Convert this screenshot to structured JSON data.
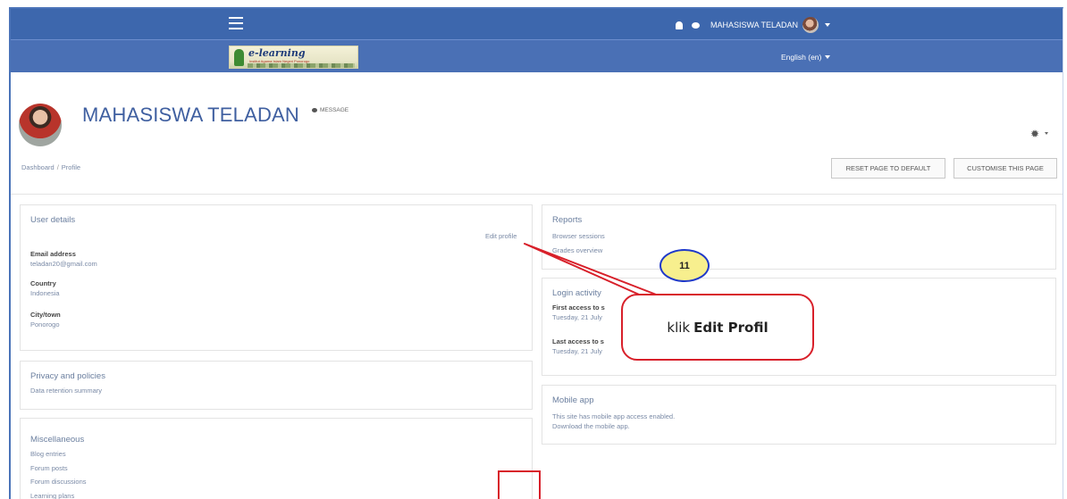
{
  "topbar": {
    "menu_icon": "hamburger-icon",
    "user_name": "MAHASISWA TELADAN"
  },
  "brand": {
    "logo_title": "e-learning",
    "logo_subtitle": "Institut Agama Islam Negeri Ponorogo",
    "language": "English (en)"
  },
  "header": {
    "name": "MAHASISWA TELADAN",
    "message_label": "MESSAGE",
    "breadcrumb": [
      "Dashboard",
      "Profile"
    ],
    "reset_button": "RESET PAGE TO DEFAULT",
    "customise_button": "CUSTOMISE THIS PAGE"
  },
  "user_details": {
    "title": "User details",
    "edit_profile": "Edit profile",
    "email_label": "Email address",
    "email_value": "teladan20@gmail.com",
    "country_label": "Country",
    "country_value": "Indonesia",
    "city_label": "City/town",
    "city_value": "Ponorogo"
  },
  "privacy": {
    "title": "Privacy and policies",
    "link": "Data retention summary"
  },
  "misc": {
    "title": "Miscellaneous",
    "links": [
      "Blog entries",
      "Forum posts",
      "Forum discussions",
      "Learning plans"
    ]
  },
  "reports": {
    "title": "Reports",
    "links": [
      "Browser sessions",
      "Grades overview"
    ]
  },
  "login_activity": {
    "title": "Login activity",
    "first_label": "First access to s",
    "first_value": "Tuesday, 21 July",
    "last_label": "Last access to s",
    "last_value": "Tuesday, 21 July"
  },
  "mobile_app": {
    "title": "Mobile app",
    "text": "This site has mobile app access enabled.",
    "link": "Download the mobile app."
  },
  "annotation": {
    "step_number": "11",
    "instruction_prefix": "klik",
    "instruction_bold": "Edit Profil"
  },
  "colors": {
    "topbar": "#3d67ad",
    "brandbar": "#4a70b5",
    "callout_red": "#d8202a",
    "callout_circle": "#f7ef8e"
  }
}
